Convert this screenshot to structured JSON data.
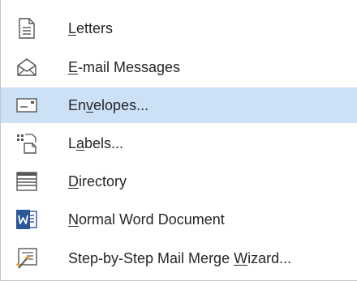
{
  "menu": {
    "items": [
      {
        "pre": "",
        "key": "L",
        "post": "etters",
        "icon": "letter-page-icon"
      },
      {
        "pre": "",
        "key": "E",
        "post": "-mail Messages",
        "icon": "email-envelope-icon"
      },
      {
        "pre": "En",
        "key": "v",
        "post": "elopes...",
        "icon": "envelope-icon"
      },
      {
        "pre": "L",
        "key": "a",
        "post": "bels...",
        "icon": "labels-icon"
      },
      {
        "pre": "",
        "key": "D",
        "post": "irectory",
        "icon": "directory-icon"
      },
      {
        "pre": "",
        "key": "N",
        "post": "ormal Word Document",
        "icon": "word-document-icon"
      },
      {
        "pre": "Step-by-Step Mail Merge ",
        "key": "W",
        "post": "izard...",
        "icon": "wizard-icon"
      }
    ],
    "highlight_color": "#cde1f6"
  }
}
